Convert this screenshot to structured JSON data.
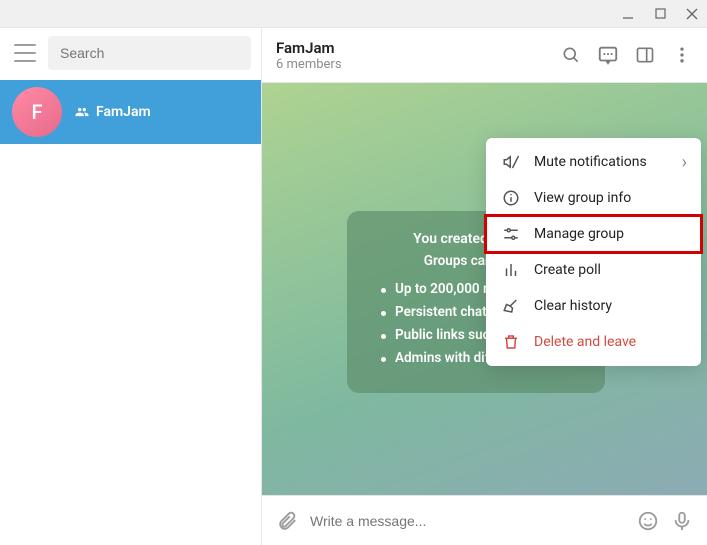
{
  "titlebar": {
    "tooltip_min": "Minimize",
    "tooltip_max": "Maximize",
    "tooltip_close": "Close"
  },
  "sidebar": {
    "search_placeholder": "Search",
    "items": [
      {
        "name": "FamJam",
        "avatar_letter": "F"
      }
    ]
  },
  "header": {
    "title": "FamJam",
    "subtitle": "6 members"
  },
  "info_card": {
    "line1": "You created a group",
    "line2": "Groups can have:",
    "bullets": [
      "Up to 200,000 members",
      "Persistent chat history",
      "Public links such as t.me/title",
      "Admins with different rights"
    ]
  },
  "composer": {
    "placeholder": "Write a message..."
  },
  "menu": {
    "items": [
      {
        "key": "mute",
        "label": "Mute notifications",
        "has_arrow": true
      },
      {
        "key": "info",
        "label": "View group info"
      },
      {
        "key": "manage",
        "label": "Manage group",
        "highlighted": true
      },
      {
        "key": "poll",
        "label": "Create poll"
      },
      {
        "key": "clear",
        "label": "Clear history"
      },
      {
        "key": "delete",
        "label": "Delete and leave",
        "danger": true
      }
    ]
  }
}
